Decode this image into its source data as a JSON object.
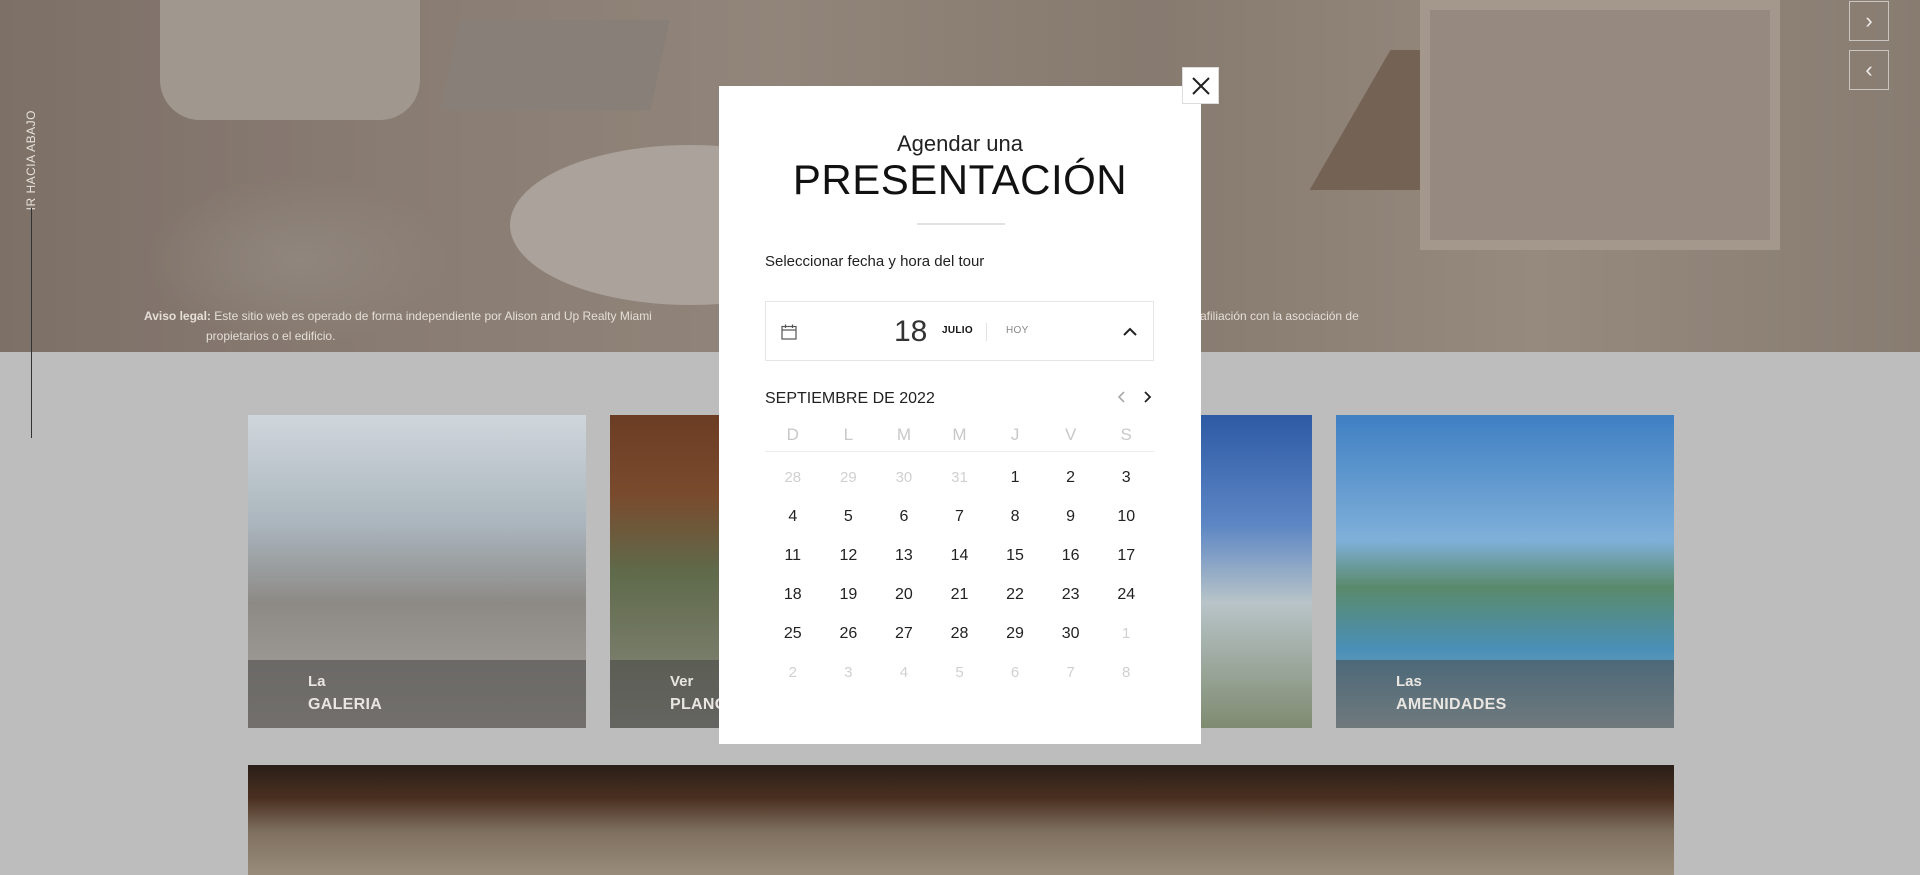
{
  "hero": {
    "scroll_label": "IR HACIA ABAJO",
    "legal_label": "Aviso legal:",
    "legal_text_left": "Este sitio web es operado de forma independiente por Alison and Up Realty Miami",
    "legal_text_left_line2": "propietarios o el edificio.",
    "legal_text_right": "afiliación con la asociación de"
  },
  "cards": [
    {
      "pre": "La",
      "name": "GALERIA"
    },
    {
      "pre": "Ver",
      "name": "PLANOS"
    },
    {
      "pre": "",
      "name": ""
    },
    {
      "pre": "Las",
      "name": "AMENIDADES"
    }
  ],
  "modal": {
    "title_top": "Agendar una",
    "title_main": "PRESENTACIÓN",
    "subtitle": "Seleccionar fecha y hora del tour",
    "date": {
      "day": "18",
      "month": "JULIO",
      "today_label": "HOY"
    },
    "calendar": {
      "month_label": "SEPTIEMBRE DE 2022",
      "weekdays": [
        "D",
        "L",
        "M",
        "M",
        "J",
        "V",
        "S"
      ],
      "weeks": [
        [
          "28",
          "29",
          "30",
          "31",
          "1",
          "2",
          "3"
        ],
        [
          "4",
          "5",
          "6",
          "7",
          "8",
          "9",
          "10"
        ],
        [
          "11",
          "12",
          "13",
          "14",
          "15",
          "16",
          "17"
        ],
        [
          "18",
          "19",
          "20",
          "21",
          "22",
          "23",
          "24"
        ],
        [
          "25",
          "26",
          "27",
          "28",
          "29",
          "30",
          "1"
        ],
        [
          "2",
          "3",
          "4",
          "5",
          "6",
          "7",
          "8"
        ]
      ],
      "muted": [
        [
          true,
          true,
          true,
          true,
          false,
          false,
          false
        ],
        [
          false,
          false,
          false,
          false,
          false,
          false,
          false
        ],
        [
          false,
          false,
          false,
          false,
          false,
          false,
          false
        ],
        [
          false,
          false,
          false,
          false,
          false,
          false,
          false
        ],
        [
          false,
          false,
          false,
          false,
          false,
          false,
          true
        ],
        [
          true,
          true,
          true,
          true,
          true,
          true,
          true
        ]
      ]
    }
  },
  "colors": {
    "overlay_bg": "#bdbdbd",
    "modal_bg": "#ffffff",
    "muted_day": "#d0d0d0"
  }
}
